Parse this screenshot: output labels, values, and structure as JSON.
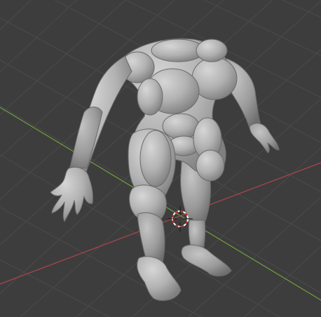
{
  "viewport": {
    "background_color": "#3d3d3d",
    "grid_color": "#4a4a4a",
    "x_axis_color": "#a8454b",
    "y_axis_color": "#6f9a3c",
    "model_color": "#b4b4b4",
    "model_shade_color": "#8c8c8c",
    "cursor_color": "#d03030"
  },
  "scene": {
    "object": "sculpted-humanoid-mesh",
    "icons": [
      "3d-cursor-icon"
    ]
  }
}
